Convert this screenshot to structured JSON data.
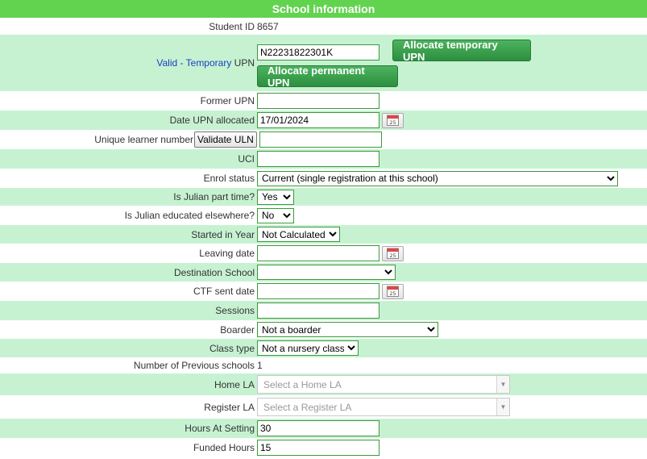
{
  "title": "School information",
  "student_id": {
    "label": "Student ID",
    "value": "8657"
  },
  "upn": {
    "status_valid": "Valid",
    "status_sep": " - ",
    "status_temp": "Temporary",
    "label": " UPN",
    "value": "N22231822301K",
    "temp_button": "Allocate temporary UPN",
    "perm_button": "Allocate permanent UPN"
  },
  "former_upn": {
    "label": "Former UPN",
    "value": ""
  },
  "date_upn": {
    "label": "Date UPN allocated",
    "value": "17/01/2024"
  },
  "uln": {
    "label": "Unique learner number",
    "button": "Validate ULN",
    "value": ""
  },
  "uci": {
    "label": "UCI",
    "value": ""
  },
  "enrol_status": {
    "label": "Enrol status",
    "value": "Current (single registration at this school)"
  },
  "part_time": {
    "label": "Is Julian part time?",
    "value": "Yes"
  },
  "educated_elsewhere": {
    "label": "Is Julian educated elsewhere?",
    "value": "No"
  },
  "started_in_year": {
    "label": "Started in Year",
    "value": "Not Calculated"
  },
  "leaving_date": {
    "label": "Leaving date",
    "value": ""
  },
  "destination_school": {
    "label": "Destination School",
    "value": ""
  },
  "ctf_sent_date": {
    "label": "CTF sent date",
    "value": ""
  },
  "sessions": {
    "label": "Sessions",
    "value": ""
  },
  "boarder": {
    "label": "Boarder",
    "value": "Not a boarder"
  },
  "class_type": {
    "label": "Class type",
    "value": "Not a nursery class"
  },
  "previous_schools": {
    "label": "Number of Previous schools",
    "value": "1"
  },
  "home_la": {
    "label": "Home LA",
    "placeholder": "Select a Home LA"
  },
  "register_la": {
    "label": "Register LA",
    "placeholder": "Select a Register LA"
  },
  "hours_at_setting": {
    "label": "Hours At Setting",
    "value": "30"
  },
  "funded_hours": {
    "label": "Funded Hours",
    "value": "15"
  },
  "calendar_icon_text": "25",
  "colors": {
    "header": "#62d34f",
    "row_alt": "#c7f2d2",
    "button": "#2d8f40",
    "link": "#1a3fc0"
  }
}
